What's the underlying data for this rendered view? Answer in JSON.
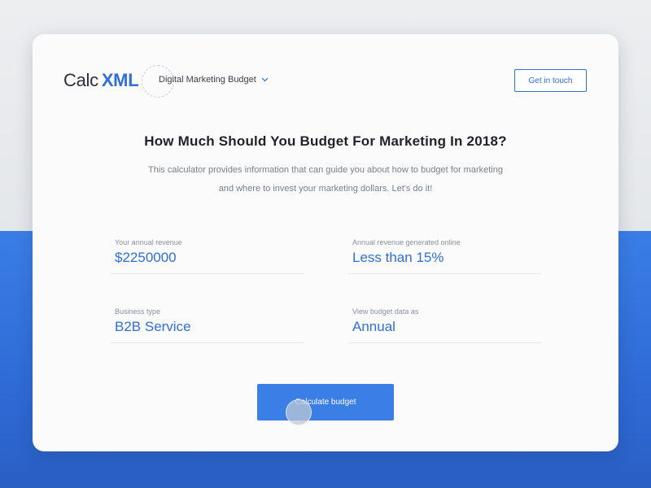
{
  "header": {
    "logo": {
      "part1": "Calc",
      "part2": "XML"
    },
    "nav_dropdown_label": "Digital Marketing Budget",
    "get_in_touch_label": "Get in touch"
  },
  "hero": {
    "title": "How Much Should You Budget For Marketing In 2018?",
    "subtitle": "This calculator provides information that can guide you about how to budget for marketing and where to invest your marketing dollars. Let's do it!"
  },
  "form": {
    "fields": [
      {
        "label": "Your annual revenue",
        "value": "$2250000"
      },
      {
        "label": "Annual revenue generated online",
        "value": "Less than 15%"
      },
      {
        "label": "Business type",
        "value": "B2B Service"
      },
      {
        "label": "View budget data as",
        "value": "Annual"
      }
    ],
    "submit_label": "Calculate budget"
  },
  "colors": {
    "accent": "#2f6fdc",
    "button": "#3b7ee6",
    "background_blue": "#3a7de6",
    "background_gray": "#eceef0"
  },
  "icons": {
    "dropdown": "chevron-down-icon"
  }
}
